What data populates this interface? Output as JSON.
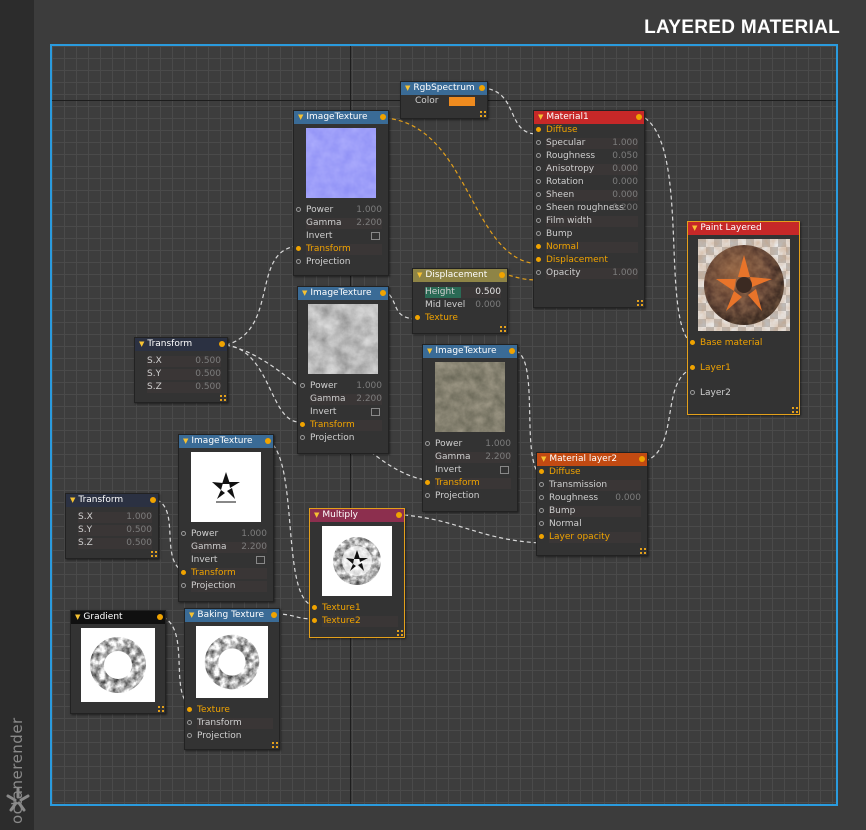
{
  "page": {
    "title": "LAYERED MATERIAL",
    "brand": "octanerender"
  },
  "colors": {
    "accent": "#2a9bde",
    "pin": "#f0a300",
    "swatch": "#ef8b1f"
  },
  "nodes": {
    "rgb": {
      "title": "RgbSpectrum",
      "color_label": "Color"
    },
    "imgtex1": {
      "title": "ImageTexture",
      "power": "Power",
      "power_v": "1.000",
      "gamma": "Gamma",
      "gamma_v": "2.200",
      "invert": "Invert",
      "transform": "Transform",
      "projection": "Projection"
    },
    "material1": {
      "title": "Material1",
      "rows": [
        {
          "label": "Diffuse",
          "value": ""
        },
        {
          "label": "Specular",
          "value": "1.000"
        },
        {
          "label": "Roughness",
          "value": "0.050"
        },
        {
          "label": "Anisotropy",
          "value": "0.000"
        },
        {
          "label": "Rotation",
          "value": "0.000"
        },
        {
          "label": "Sheen",
          "value": "0.000"
        },
        {
          "label": "Sheen roughness",
          "value": "0.200"
        },
        {
          "label": "Film width",
          "value": ""
        },
        {
          "label": "Bump",
          "value": ""
        },
        {
          "label": "Normal",
          "value": ""
        },
        {
          "label": "Displacement",
          "value": ""
        },
        {
          "label": "Opacity",
          "value": "1.000"
        }
      ]
    },
    "paint": {
      "title": "Paint Layered",
      "base": "Base material",
      "layer1": "Layer1",
      "layer2": "Layer2"
    },
    "displacement": {
      "title": "Displacement",
      "height": "Height",
      "height_v": "0.500",
      "mid": "Mid level",
      "mid_v": "0.000",
      "texture": "Texture"
    },
    "imgtex2": {
      "title": "ImageTexture",
      "power": "Power",
      "power_v": "1.000",
      "gamma": "Gamma",
      "gamma_v": "2.200",
      "invert": "Invert",
      "transform": "Transform",
      "projection": "Projection"
    },
    "transform1": {
      "title": "Transform",
      "sx": "S.X",
      "sx_v": "0.500",
      "sy": "S.Y",
      "sy_v": "0.500",
      "sz": "S.Z",
      "sz_v": "0.500"
    },
    "imgtex3": {
      "title": "ImageTexture",
      "power": "Power",
      "power_v": "1.000",
      "gamma": "Gamma",
      "gamma_v": "2.200",
      "invert": "Invert",
      "transform": "Transform",
      "projection": "Projection"
    },
    "layer2": {
      "title": "Material layer2",
      "rows": [
        {
          "label": "Diffuse",
          "value": ""
        },
        {
          "label": "Transmission",
          "value": ""
        },
        {
          "label": "Roughness",
          "value": "0.000"
        },
        {
          "label": "Bump",
          "value": ""
        },
        {
          "label": "Normal",
          "value": ""
        },
        {
          "label": "Layer opacity",
          "value": ""
        }
      ]
    },
    "imgtex4": {
      "title": "ImageTexture",
      "power": "Power",
      "power_v": "1.000",
      "gamma": "Gamma",
      "gamma_v": "2.200",
      "invert": "Invert",
      "transform": "Transform",
      "projection": "Projection"
    },
    "transform2": {
      "title": "Transform",
      "sx": "S.X",
      "sx_v": "1.000",
      "sy": "S.Y",
      "sy_v": "0.500",
      "sz": "S.Z",
      "sz_v": "0.500"
    },
    "multiply": {
      "title": "Multiply",
      "t1": "Texture1",
      "t2": "Texture2"
    },
    "gradient": {
      "title": "Gradient"
    },
    "baking": {
      "title": "Baking Texture",
      "texture": "Texture",
      "transform": "Transform",
      "projection": "Projection"
    }
  }
}
